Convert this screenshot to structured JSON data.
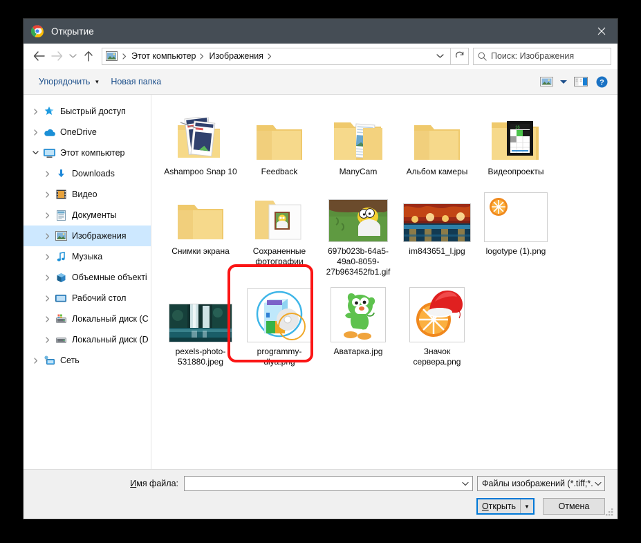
{
  "window": {
    "title": "Открытие",
    "app_icon": "chrome-icon",
    "close_label": "✕",
    "titlebar_color": "#454d55"
  },
  "nav": {
    "back": "back-arrow",
    "forward": "forward-arrow",
    "recent": "recent-locations",
    "up": "up-arrow",
    "breadcrumbs": [
      "Этот компьютер",
      "Изображения"
    ],
    "location_icon": "pictures-icon",
    "refresh": "refresh-icon"
  },
  "search": {
    "placeholder": "Поиск: Изображения",
    "icon": "search-icon"
  },
  "toolbar": {
    "organize_label": "Упорядочить",
    "new_folder_label": "Новая папка",
    "view_icon": "view-icon",
    "pane_icon": "preview-pane-icon",
    "help_icon": "help-icon"
  },
  "sidebar": {
    "items": [
      {
        "label": "Быстрый доступ",
        "icon": "quick-access-icon",
        "indent": 0,
        "expanded": false,
        "selected": false
      },
      {
        "label": "OneDrive",
        "icon": "onedrive-icon",
        "indent": 0,
        "expanded": false,
        "selected": false
      },
      {
        "label": "Этот компьютер",
        "icon": "computer-icon",
        "indent": 0,
        "expanded": true,
        "selected": false
      },
      {
        "label": "Downloads",
        "icon": "downloads-icon",
        "indent": 1,
        "expanded": false,
        "selected": false
      },
      {
        "label": "Видео",
        "icon": "videos-icon",
        "indent": 1,
        "expanded": false,
        "selected": false
      },
      {
        "label": "Документы",
        "icon": "documents-icon",
        "indent": 1,
        "expanded": false,
        "selected": false
      },
      {
        "label": "Изображения",
        "icon": "pictures-icon",
        "indent": 1,
        "expanded": false,
        "selected": true
      },
      {
        "label": "Музыка",
        "icon": "music-icon",
        "indent": 1,
        "expanded": false,
        "selected": false
      },
      {
        "label": "Объемные объекті",
        "icon": "3dobjects-icon",
        "indent": 1,
        "expanded": false,
        "selected": false
      },
      {
        "label": "Рабочий стол",
        "icon": "desktop-icon",
        "indent": 1,
        "expanded": false,
        "selected": false
      },
      {
        "label": "Локальный диск (C",
        "icon": "system-drive-icon",
        "indent": 1,
        "expanded": false,
        "selected": false
      },
      {
        "label": "Локальный диск (D",
        "icon": "drive-icon",
        "indent": 1,
        "expanded": false,
        "selected": false
      },
      {
        "label": "Сеть",
        "icon": "network-icon",
        "indent": 0,
        "expanded": false,
        "selected": false
      }
    ]
  },
  "files": {
    "items": [
      {
        "name": "Ashampoo Snap 10",
        "kind": "folder-with-preview",
        "preview": "snap"
      },
      {
        "name": "Feedback",
        "kind": "folder",
        "preview": ""
      },
      {
        "name": "ManyCam",
        "kind": "folder-with-preview",
        "preview": "manycam"
      },
      {
        "name": "Альбом камеры",
        "kind": "folder",
        "preview": ""
      },
      {
        "name": "Видеопроекты",
        "kind": "folder-with-preview",
        "preview": "video"
      },
      {
        "name": "Снимки экрана",
        "kind": "folder",
        "preview": ""
      },
      {
        "name": "Сохраненные фотографии",
        "kind": "folder-with-preview",
        "preview": "homer"
      },
      {
        "name": "697b023b-64a5-49a0-8059-27b963452fb1.gif",
        "kind": "image",
        "preview": "homer-wide"
      },
      {
        "name": "im843651_l.jpg",
        "kind": "image",
        "preview": "painting"
      },
      {
        "name": "logotype (1).png",
        "kind": "image",
        "preview": "orange-logo"
      },
      {
        "name": "pexels-photo-531880.jpeg",
        "kind": "image",
        "preview": "city"
      },
      {
        "name": "programmy-dlya.png",
        "kind": "image",
        "preview": "software-box"
      },
      {
        "name": "Аватарка.jpg",
        "kind": "image",
        "preview": "yoshi"
      },
      {
        "name": "Значок сервера.png",
        "kind": "image",
        "preview": "orange-santa"
      }
    ],
    "highlight_color": "#fb1515",
    "highlighted_item": "Значок сервера.png"
  },
  "footer": {
    "filename_label_prefix": "И",
    "filename_label_rest": "мя файла:",
    "filename_value": "",
    "filetype_value": "Файлы изображений (*.tiff;*.p",
    "open_label_prefix": "О",
    "open_label_rest": "ткрыть",
    "cancel_label": "Отмена",
    "resize_grip": "resize-grip"
  }
}
